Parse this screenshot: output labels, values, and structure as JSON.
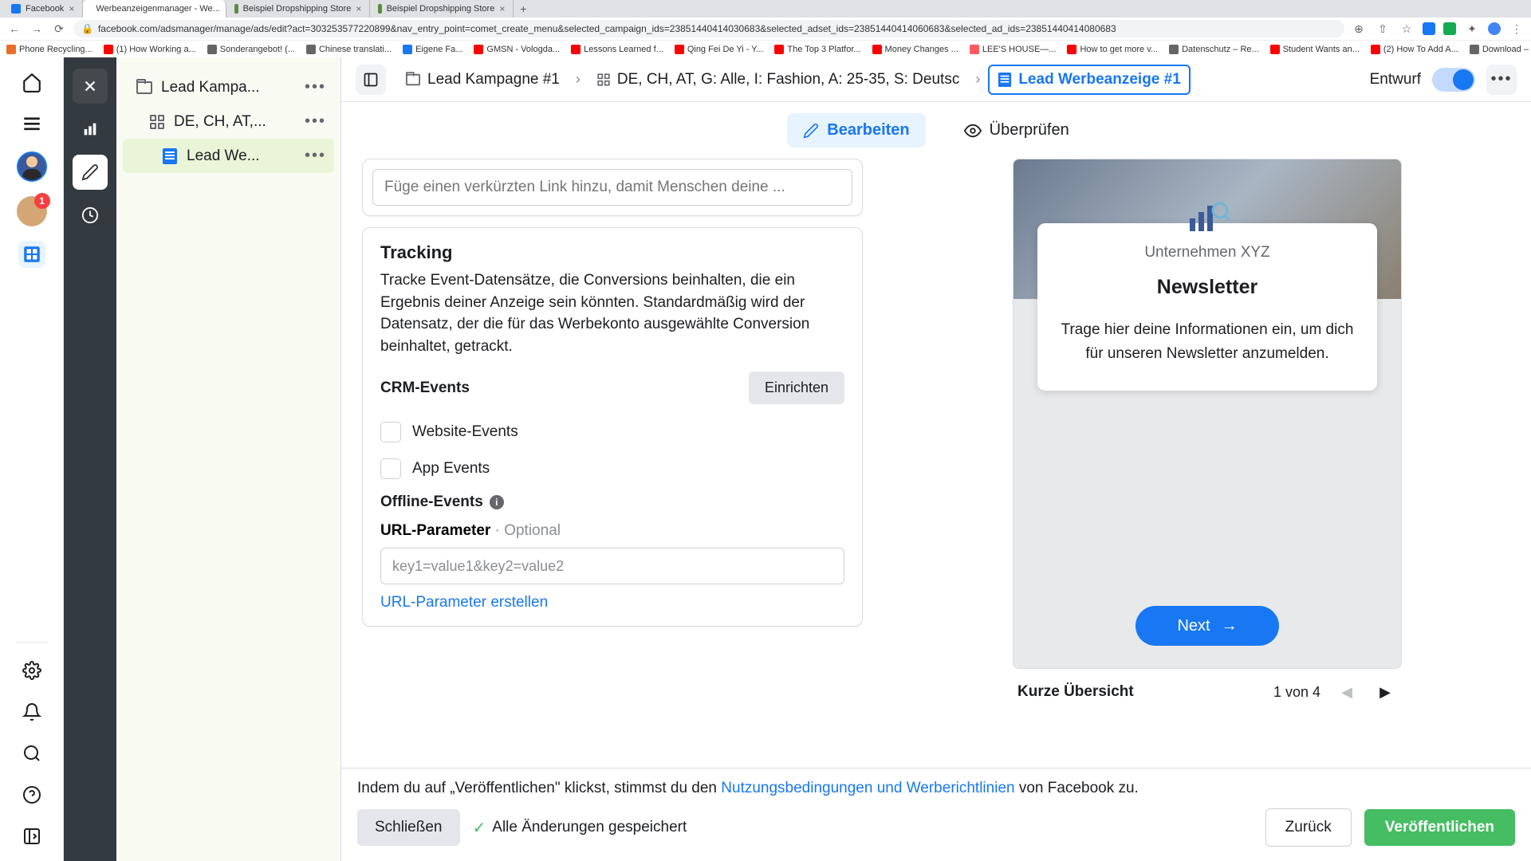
{
  "browser": {
    "tabs": [
      {
        "label": "Facebook",
        "active": false
      },
      {
        "label": "Werbeanzeigenmanager - We...",
        "active": true
      },
      {
        "label": "Beispiel Dropshipping Store",
        "active": false
      },
      {
        "label": "Beispiel Dropshipping Store",
        "active": false
      }
    ],
    "url": "facebook.com/adsmanager/manage/ads/edit?act=303253577220899&nav_entry_point=comet_create_menu&selected_campaign_ids=23851440414030683&selected_adset_ids=23851440414060683&selected_ad_ids=23851440414080683",
    "bookmarks": [
      "Phone Recycling...",
      "(1) How Working a...",
      "Sonderangebot! (...",
      "Chinese translati...",
      "Eigene Fa...",
      "GMSN - Vologda...",
      "Lessons Learned f...",
      "Qing Fei De Yi - Y...",
      "The Top 3 Platfor...",
      "Money Changes ...",
      "LEE'S HOUSE—...",
      "How to get more v...",
      "Datenschutz – Re...",
      "Student Wants an...",
      "(2) How To Add A...",
      "Download – Cooki..."
    ]
  },
  "rail": {
    "badge": "1"
  },
  "tree": {
    "campaign": "Lead Kampa...",
    "adset": "DE, CH, AT,...",
    "ad": "Lead We..."
  },
  "breadcrumb": {
    "campaign": "Lead Kampagne #1",
    "adset": "DE, CH, AT, G: Alle, I: Fashion, A: 25-35, S: Deutsc",
    "ad": "Lead Werbeanzeige #1",
    "status": "Entwurf"
  },
  "tabs": {
    "edit": "Bearbeiten",
    "review": "Überprüfen"
  },
  "form": {
    "link_placeholder": "Füge einen verkürzten Link hinzu, damit Menschen deine ...",
    "tracking_h": "Tracking",
    "tracking_desc": "Tracke Event-Datensätze, die Conversions beinhalten, die ein Ergebnis deiner Anzeige sein könnten. Standardmäßig wird der Datensatz, der die für das Werbekonto ausgewählte Conversion beinhaltet, getrackt.",
    "crm_events": "CRM-Events",
    "setup": "Einrichten",
    "website_events": "Website-Events",
    "app_events": "App Events",
    "offline_events": "Offline-Events",
    "url_param": "URL-Parameter",
    "optional": " · Optional",
    "url_placeholder": "key1=value1&key2=value2",
    "create_params": "URL-Parameter erstellen"
  },
  "preview": {
    "company": "Unternehmen XYZ",
    "title": "Newsletter",
    "desc": "Trage hier deine Informationen ein, um dich für unseren Newsletter anzumelden.",
    "next": "Next",
    "overview": "Kurze Übersicht",
    "page": "1 von 4"
  },
  "footer": {
    "consent_pre": "Indem du auf „Veröffentlichen\" klickst, stimmst du den ",
    "consent_link": "Nutzungsbedingungen und Werberichtlinien",
    "consent_post": " von Facebook zu.",
    "close": "Schließen",
    "saved": "Alle Änderungen gespeichert",
    "back": "Zurück",
    "publish": "Veröffentlichen"
  }
}
